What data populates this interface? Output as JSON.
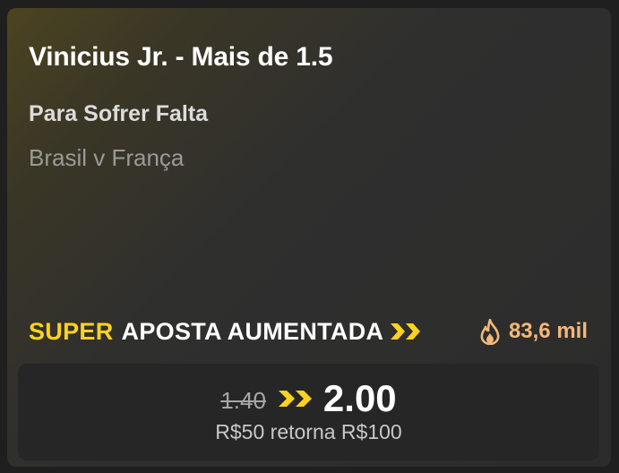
{
  "selection": {
    "title": "Vinicius Jr. - Mais de 1.5",
    "market": "Para Sofrer Falta",
    "event": "Brasil v França"
  },
  "promo": {
    "super_label": "SUPER",
    "label": "APOSTA AUMENTADA",
    "accent_color": "#ffd21f",
    "icon": "double-chevron-right-icon"
  },
  "popularity": {
    "icon": "fire-icon",
    "count": "83,6 mil",
    "color": "#f3b87a"
  },
  "odds": {
    "original": "1.40",
    "boosted": "2.00",
    "returns_text": "R$50 retorna R$100"
  }
}
